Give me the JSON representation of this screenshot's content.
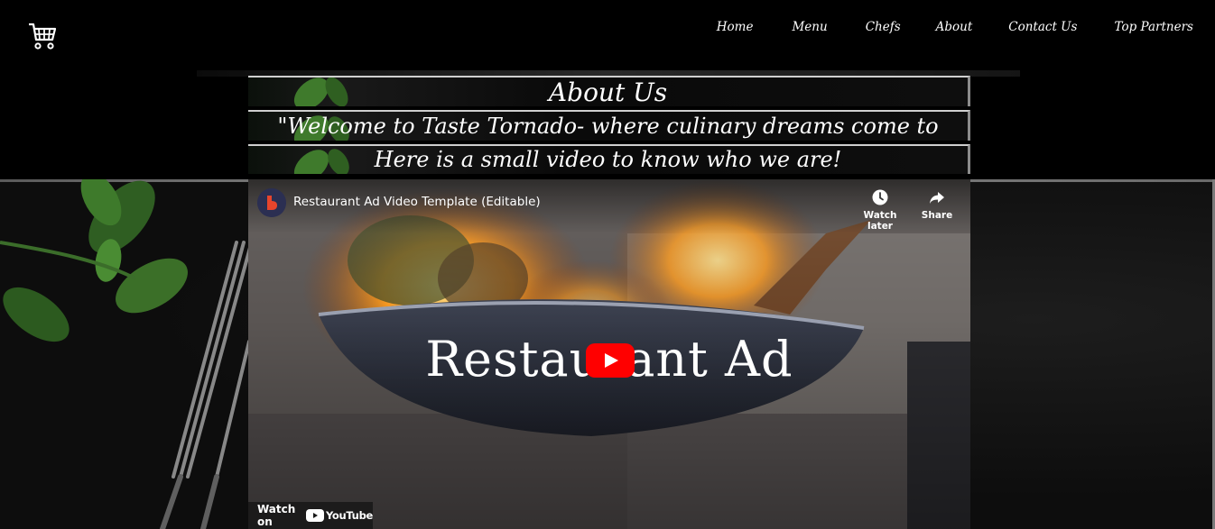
{
  "nav": {
    "cart_icon": "cart-icon",
    "items": [
      {
        "label": "Home"
      },
      {
        "label": "Menu"
      },
      {
        "label": "Chefs"
      },
      {
        "label": "About"
      },
      {
        "label": "Contact Us"
      },
      {
        "label": "Top Partners"
      }
    ]
  },
  "hero": {
    "title": "About Us",
    "welcome": "\"Welcome to Taste Tornado- where culinary dreams come to life!\"",
    "subtitle": "Here is a small video to know who we are!"
  },
  "video": {
    "title": "Restaurant Ad Video Template (Editable)",
    "watch_later": "Watch later",
    "share": "Share",
    "headline": "Restaurant Ad",
    "watch_on": "Watch on",
    "youtube": "YouTube",
    "colors": {
      "play_red": "#ff0000",
      "avatar_accent": "#e8452c"
    }
  }
}
